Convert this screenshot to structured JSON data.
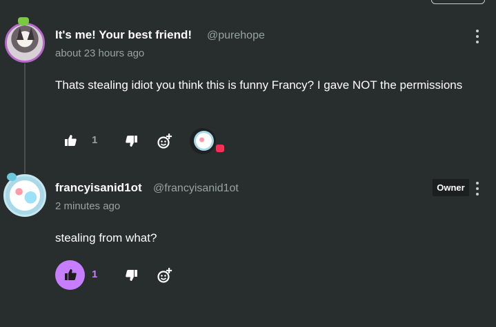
{
  "comments": [
    {
      "display_name": "It's me! Your best friend!",
      "handle": "@purehope",
      "time": "about 23 hours ago",
      "body": "Thats stealing idiot you think this is funny Francy? I gave NOT the permissions",
      "likes": "1",
      "liked": false,
      "has_reaction": true
    },
    {
      "display_name": "francyisanid1ot",
      "handle": "@francyisanid1ot",
      "time": "2 minutes ago",
      "body": "stealing from what?",
      "badge": "Owner",
      "likes": "1",
      "liked": true,
      "has_reaction": false
    }
  ],
  "icons": {
    "like": "thumbs-up-icon",
    "dislike": "thumbs-down-icon",
    "react": "add-reaction-icon",
    "more": "more-vertical-icon"
  },
  "colors": {
    "background": "#282d2d",
    "accent": "#c77dff",
    "muted": "#9aa2a2",
    "reaction_badge": "#ff2d55",
    "avatar_ring": "#b769c9"
  }
}
